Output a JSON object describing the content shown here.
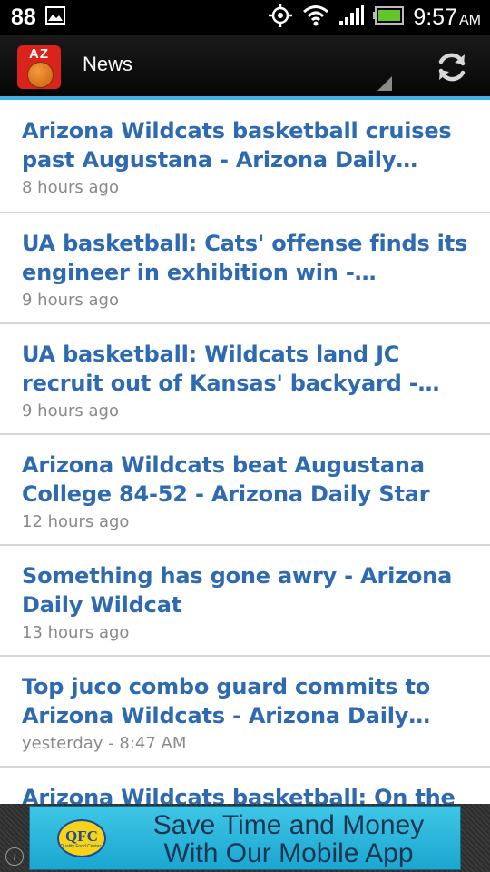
{
  "status_bar": {
    "notification_count": "88",
    "time": "9:57",
    "ampm": "AM"
  },
  "app_bar": {
    "logo_text": "AZ",
    "title": "News"
  },
  "news": [
    {
      "title": "Arizona Wildcats basketball cruises past Augustana - Arizona Daily Wildcat",
      "time": "8 hours ago"
    },
    {
      "title": "UA basketball: Cats' offense finds its engineer in exhibition win - Arizona…",
      "time": "9 hours ago"
    },
    {
      "title": "UA basketball: Wildcats land JC recruit out of Kansas' backyard - Arizona Dail…",
      "time": "9 hours ago"
    },
    {
      "title": "Arizona Wildcats beat Augustana College 84-52 - Arizona Daily Star",
      "time": "12 hours ago"
    },
    {
      "title": "Something has gone awry - Arizona Daily Wildcat",
      "time": "13 hours ago"
    },
    {
      "title": "Top juco combo guard commits to Arizona Wildcats - Arizona Daily Star…",
      "time": "yesterday - 8:47 AM"
    },
    {
      "title": "Arizona Wildcats basketball: On the",
      "time": ""
    }
  ],
  "ad": {
    "logo_text": "QFC",
    "logo_subtext": "Quality Food Centers",
    "line1": "Save Time and Money",
    "line2": "With Our Mobile App"
  }
}
